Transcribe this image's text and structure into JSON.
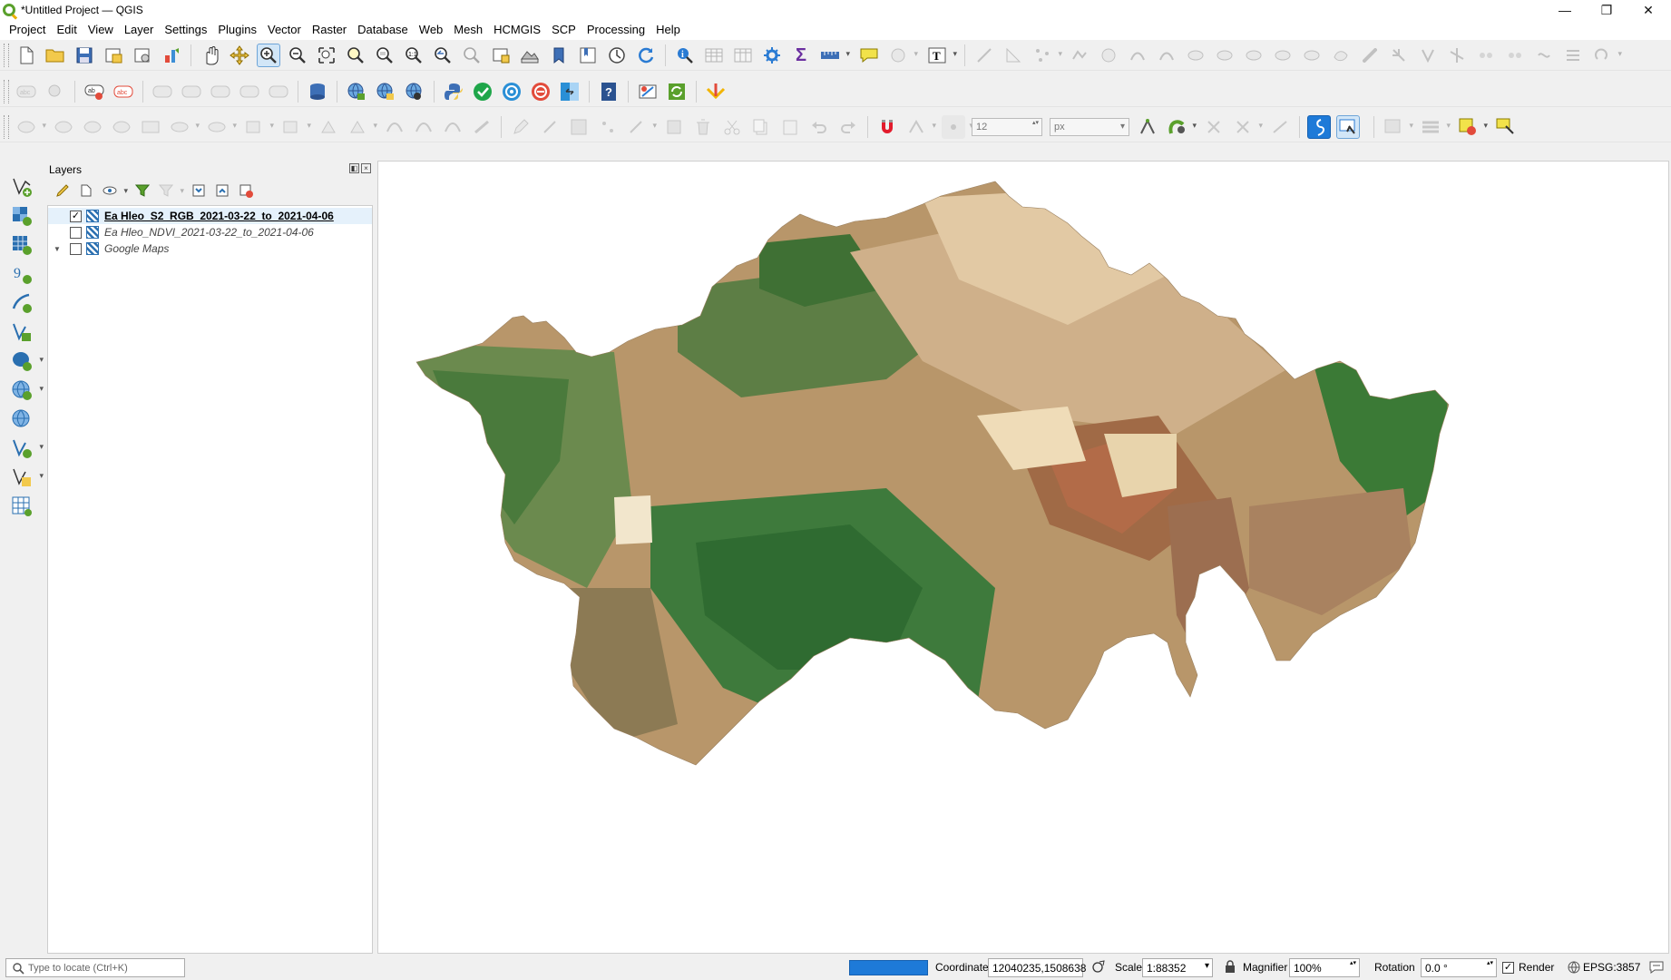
{
  "window": {
    "title": "*Untitled Project — QGIS",
    "minimize": "—",
    "restore": "❐",
    "close": "✕"
  },
  "menu": [
    "Project",
    "Edit",
    "View",
    "Layer",
    "Settings",
    "Plugins",
    "Vector",
    "Raster",
    "Database",
    "Web",
    "Mesh",
    "HCMGIS",
    "SCP",
    "Processing",
    "Help"
  ],
  "snapping": {
    "tolerance": "12",
    "unit": "px"
  },
  "layers_panel": {
    "title": "Layers",
    "layers": [
      {
        "name": "Ea Hleo_S2_RGB_2021-03-22_to_2021-04-06",
        "checked": true,
        "style": "bold-underline"
      },
      {
        "name": "Ea Hleo_NDVI_2021-03-22_to_2021-04-06",
        "checked": false,
        "style": "italic"
      },
      {
        "name": "Google Maps",
        "checked": false,
        "style": "italic",
        "expandable": true
      }
    ]
  },
  "statusbar": {
    "locator_placeholder": "Type to locate (Ctrl+K)",
    "progress": 1.0,
    "coordinate_label": "Coordinate",
    "coordinate_value": "12040235,1508638",
    "scale_label": "Scale",
    "scale_value": "1:88352",
    "magnifier_label": "Magnifier",
    "magnifier_value": "100%",
    "rotation_label": "Rotation",
    "rotation_value": "0.0 °",
    "render_label": "Render",
    "render_checked": true,
    "crs": "EPSG:3857"
  },
  "colors": {
    "accent": "#1e7ad8",
    "vegetation": "#4a7a3c",
    "dry_land": "#b8966a",
    "bare_soil": "#e6cfa8"
  }
}
